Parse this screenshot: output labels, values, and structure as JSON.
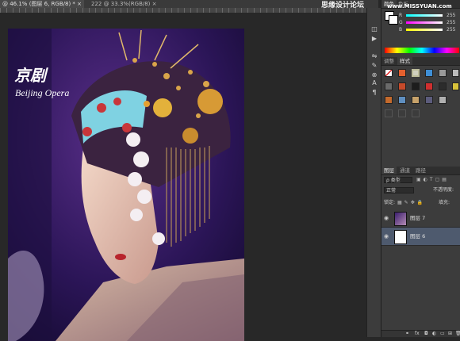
{
  "document_tabs": [
    {
      "label": "@ 46.1% (图层 6, RGB/8) *",
      "active": true
    },
    {
      "label": "222 @ 33.3%(RGB/8)",
      "active": false
    }
  ],
  "watermark": {
    "chinese": "思缘设计论坛",
    "url": "www.MISSYUAN.com"
  },
  "artwork": {
    "title_chinese": "京剧",
    "title_english": "Beijing Opera"
  },
  "tools": [
    "history-icon",
    "actions-icon",
    "adjust-icon",
    "brush-settings-icon",
    "clone-icon",
    "character-icon",
    "paragraph-icon"
  ],
  "tool_glyphs": [
    "◫",
    "▶",
    "⇋",
    "✎",
    "⊗",
    "A",
    "¶"
  ],
  "color_panel": {
    "tabs": [
      "颜色",
      "色板"
    ],
    "channels": [
      {
        "label": "R",
        "value": "255"
      },
      {
        "label": "G",
        "value": "255"
      },
      {
        "label": "B",
        "value": "255"
      }
    ]
  },
  "styles_panel": {
    "tabs": [
      "调整",
      "样式"
    ]
  },
  "layers_panel": {
    "tabs": [
      "图层",
      "通道",
      "路径"
    ],
    "filter_kind": "ρ 类型",
    "blend_mode": "正常",
    "opacity_label": "不透明度:",
    "lock_label": "锁定:",
    "fill_label": "填充:",
    "layers": [
      {
        "name": "图层 7",
        "selected": false
      },
      {
        "name": "图层 6",
        "selected": true
      }
    ]
  },
  "colors": {
    "accent_selected": "#4e5a6e",
    "panel_bg": "#3c3c3c",
    "artwork_bg": "#2a1553"
  }
}
